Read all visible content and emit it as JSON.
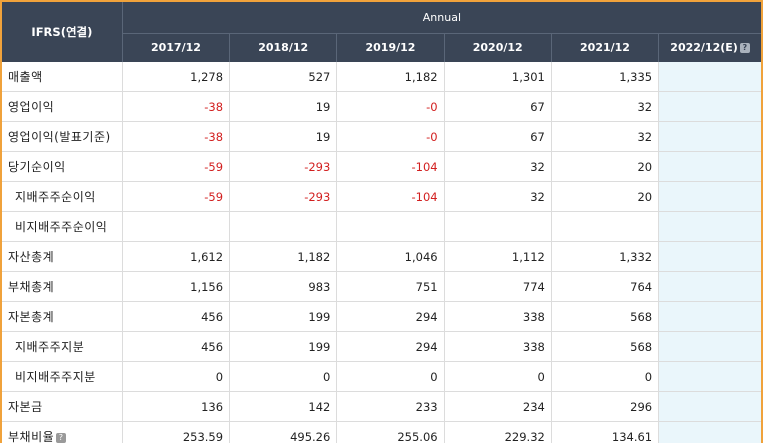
{
  "header": {
    "ifrs_label": "IFRS(연결)",
    "annual_label": "Annual",
    "years": [
      "2017/12",
      "2018/12",
      "2019/12",
      "2020/12",
      "2021/12"
    ],
    "estimate_label": "2022/12(E)",
    "help_glyph": "?"
  },
  "rows": [
    {
      "label": "매출액",
      "indent": false,
      "values": [
        "1,278",
        "527",
        "1,182",
        "1,301",
        "1,335"
      ],
      "estimate": ""
    },
    {
      "label": "영업이익",
      "indent": false,
      "values": [
        "-38",
        "19",
        "-0",
        "67",
        "32"
      ],
      "estimate": ""
    },
    {
      "label": "영업이익(발표기준)",
      "indent": false,
      "values": [
        "-38",
        "19",
        "-0",
        "67",
        "32"
      ],
      "estimate": ""
    },
    {
      "label": "당기순이익",
      "indent": false,
      "values": [
        "-59",
        "-293",
        "-104",
        "32",
        "20"
      ],
      "estimate": ""
    },
    {
      "label": "지배주주순이익",
      "indent": true,
      "values": [
        "-59",
        "-293",
        "-104",
        "32",
        "20"
      ],
      "estimate": ""
    },
    {
      "label": "비지배주주순이익",
      "indent": true,
      "values": [
        "",
        "",
        "",
        "",
        ""
      ],
      "estimate": ""
    },
    {
      "label": "자산총계",
      "indent": false,
      "values": [
        "1,612",
        "1,182",
        "1,046",
        "1,112",
        "1,332"
      ],
      "estimate": ""
    },
    {
      "label": "부채총계",
      "indent": false,
      "values": [
        "1,156",
        "983",
        "751",
        "774",
        "764"
      ],
      "estimate": ""
    },
    {
      "label": "자본총계",
      "indent": false,
      "values": [
        "456",
        "199",
        "294",
        "338",
        "568"
      ],
      "estimate": ""
    },
    {
      "label": "지배주주지분",
      "indent": true,
      "values": [
        "456",
        "199",
        "294",
        "338",
        "568"
      ],
      "estimate": ""
    },
    {
      "label": "비지배주주지분",
      "indent": true,
      "values": [
        "0",
        "0",
        "0",
        "0",
        "0"
      ],
      "estimate": ""
    },
    {
      "label": "자본금",
      "indent": false,
      "values": [
        "136",
        "142",
        "233",
        "234",
        "296"
      ],
      "estimate": ""
    },
    {
      "label": "부채비율",
      "indent": false,
      "help": true,
      "values": [
        "253.59",
        "495.26",
        "255.06",
        "229.32",
        "134.61"
      ],
      "estimate": ""
    }
  ],
  "colors": {
    "header_bg": "#3a4556",
    "negative": "#d21f1f",
    "estimate_bg": "#eaf6fb",
    "frame": "#f0a23b"
  }
}
